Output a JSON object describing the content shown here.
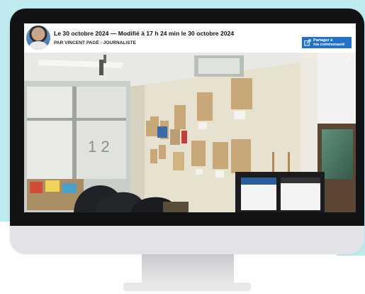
{
  "article": {
    "headline": "Le 30 octobre 2024 — Modifié à 17 h 24 min le 30 octobre 2024",
    "byline": "PAR VINCENT PAGÉ - JOURNALISTE"
  },
  "share": {
    "line1": "Partager à",
    "line2": "ma communauté"
  },
  "photo": {
    "window_text": "1 2"
  },
  "icons": {
    "share": "share-arrow-icon",
    "expand": "expand-icon"
  },
  "colors": {
    "background": "#bfeaf0",
    "share_button": "#2472c8",
    "bezel": "#111214"
  }
}
